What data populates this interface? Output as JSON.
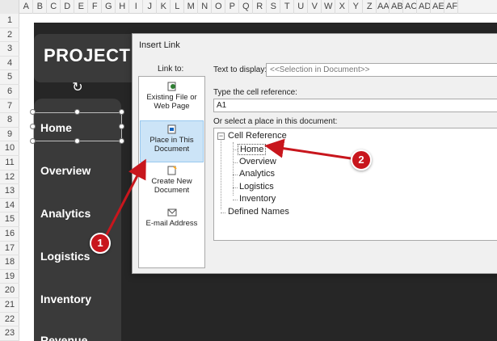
{
  "spreadsheet": {
    "columns": [
      "A",
      "B",
      "C",
      "D",
      "E",
      "F",
      "G",
      "H",
      "I",
      "J",
      "K",
      "L",
      "M",
      "N",
      "O",
      "P",
      "Q",
      "R",
      "S",
      "T",
      "U",
      "V",
      "W",
      "X",
      "Y",
      "Z",
      "AA",
      "AB",
      "AC",
      "AD",
      "AE",
      "AF"
    ],
    "rows": [
      "1",
      "2",
      "3",
      "4",
      "5",
      "6",
      "7",
      "8",
      "9",
      "10",
      "11",
      "12",
      "13",
      "14",
      "15",
      "16",
      "17",
      "18",
      "19",
      "20",
      "21",
      "22",
      "23"
    ]
  },
  "dashboard": {
    "title": "PROJECT H",
    "nav_items": [
      "Home",
      "Overview",
      "Analytics",
      "Logistics",
      "Inventory",
      "Revenue"
    ]
  },
  "dialog": {
    "title": "Insert Link",
    "link_to_label": "Link to:",
    "link_options": [
      {
        "label": "Existing File or Web Page",
        "icon": "existing-file-icon"
      },
      {
        "label": "Place in This Document",
        "icon": "place-in-document-icon"
      },
      {
        "label": "Create New Document",
        "icon": "new-document-icon"
      },
      {
        "label": "E-mail Address",
        "icon": "email-icon"
      }
    ],
    "text_to_display_label": "Text to display:",
    "text_to_display_value": "<<Selection in Document>>",
    "cell_reference_label": "Type the cell reference:",
    "cell_reference_value": "A1",
    "select_place_label": "Or select a place in this document:",
    "tree": {
      "root": "Cell Reference",
      "children": [
        "Home",
        "Overview",
        "Analytics",
        "Logistics",
        "Inventory"
      ],
      "other": "Defined Names",
      "selected": "Home"
    }
  },
  "annotations": {
    "callouts": [
      "1",
      "2"
    ],
    "color": "#c8161d"
  },
  "colors": {
    "dashboard_bg": "#262626",
    "panel_bg": "#3a3a3a",
    "selected_link": "#cce4f7"
  }
}
